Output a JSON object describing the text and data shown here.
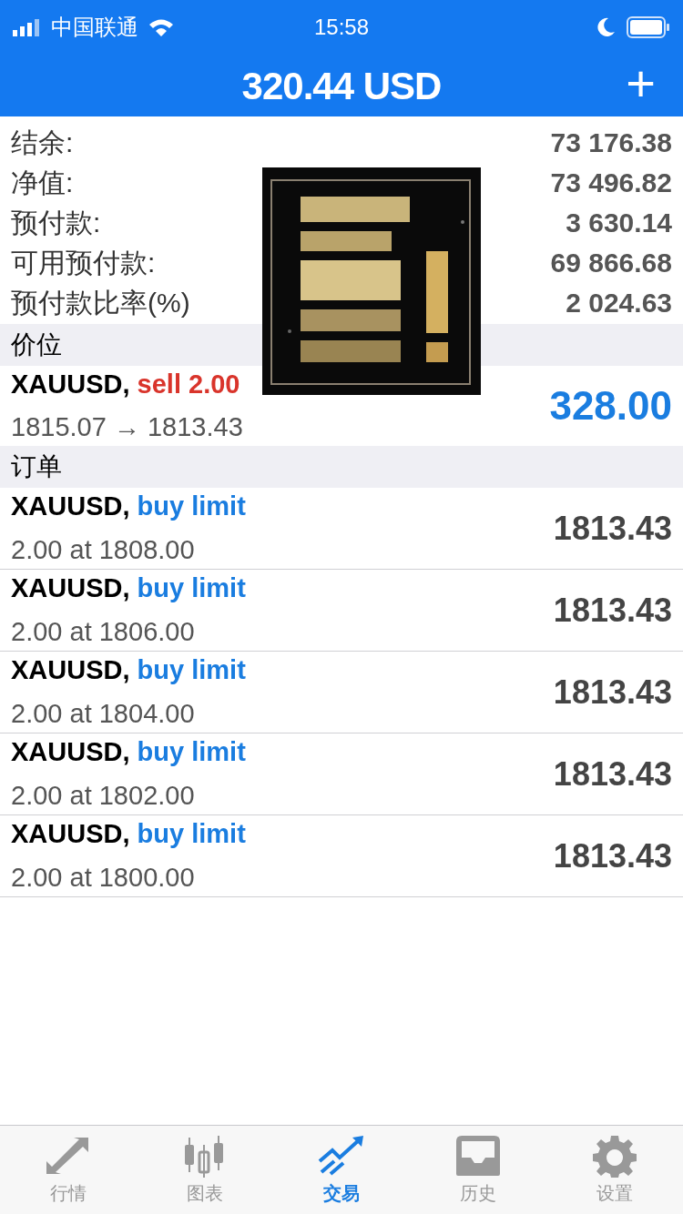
{
  "status_bar": {
    "carrier": "中国联通",
    "time": "15:58"
  },
  "header": {
    "title": "320.44 USD",
    "add_button": "+"
  },
  "account": [
    {
      "label": "结余:",
      "value": "73 176.38"
    },
    {
      "label": "净值:",
      "value": "73 496.82"
    },
    {
      "label": "预付款:",
      "value": "3 630.14"
    },
    {
      "label": "可用预付款:",
      "value": "69 866.68"
    },
    {
      "label": "预付款比率(%)",
      "value": "2 024.63"
    }
  ],
  "positions": {
    "title": "价位",
    "items": [
      {
        "symbol": "XAUUSD,",
        "kind": "sell",
        "action": "sell 2.00",
        "detail": "1815.07 → 1813.43",
        "profit": "328.00"
      }
    ]
  },
  "orders": {
    "title": "订单",
    "items": [
      {
        "symbol": "XAUUSD,",
        "kind": "buy",
        "action": "buy limit",
        "detail": "2.00 at 1808.00",
        "price": "1813.43"
      },
      {
        "symbol": "XAUUSD,",
        "kind": "buy",
        "action": "buy limit",
        "detail": "2.00 at 1806.00",
        "price": "1813.43"
      },
      {
        "symbol": "XAUUSD,",
        "kind": "buy",
        "action": "buy limit",
        "detail": "2.00 at 1804.00",
        "price": "1813.43"
      },
      {
        "symbol": "XAUUSD,",
        "kind": "buy",
        "action": "buy limit",
        "detail": "2.00 at 1802.00",
        "price": "1813.43"
      },
      {
        "symbol": "XAUUSD,",
        "kind": "buy",
        "action": "buy limit",
        "detail": "2.00 at 1800.00",
        "price": "1813.43"
      }
    ]
  },
  "tabs": [
    {
      "label": "行情",
      "kind": "quotes",
      "selected": false
    },
    {
      "label": "图表",
      "kind": "chart",
      "selected": false
    },
    {
      "label": "交易",
      "kind": "trade",
      "selected": true
    },
    {
      "label": "历史",
      "kind": "history",
      "selected": false
    },
    {
      "label": "设置",
      "kind": "settings",
      "selected": false
    }
  ]
}
